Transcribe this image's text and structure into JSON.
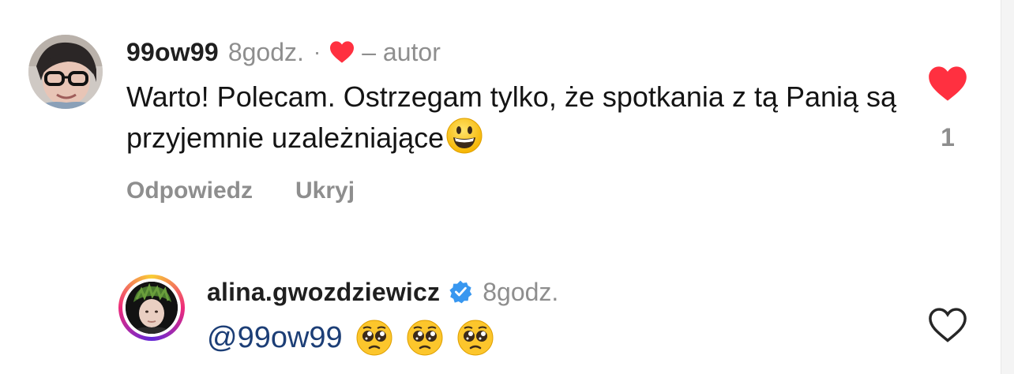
{
  "comments": [
    {
      "username": "99ow99",
      "time": "8godz.",
      "separator": "·",
      "author_label": "– autor",
      "text": "Warto! Polecam. Ostrzegam tylko, że spotkania z tą Panią są przyjemnie uzależniające",
      "emoji_icon": "grinning-face-icon",
      "liked": true,
      "like_count": "1",
      "actions": {
        "reply": "Odpowiedz",
        "hide": "Ukryj"
      }
    },
    {
      "username": "alina.gwozdziewicz",
      "verified": true,
      "time": "8godz.",
      "mention": "@99ow99",
      "emoji_icons": [
        "pleading-face-icon",
        "pleading-face-icon",
        "pleading-face-icon"
      ],
      "liked": false
    }
  ],
  "colors": {
    "like_red": "#ff3040",
    "secondary_text": "#8e8e8e",
    "verified_blue": "#3897f0",
    "mention_blue": "#1c3e76"
  }
}
